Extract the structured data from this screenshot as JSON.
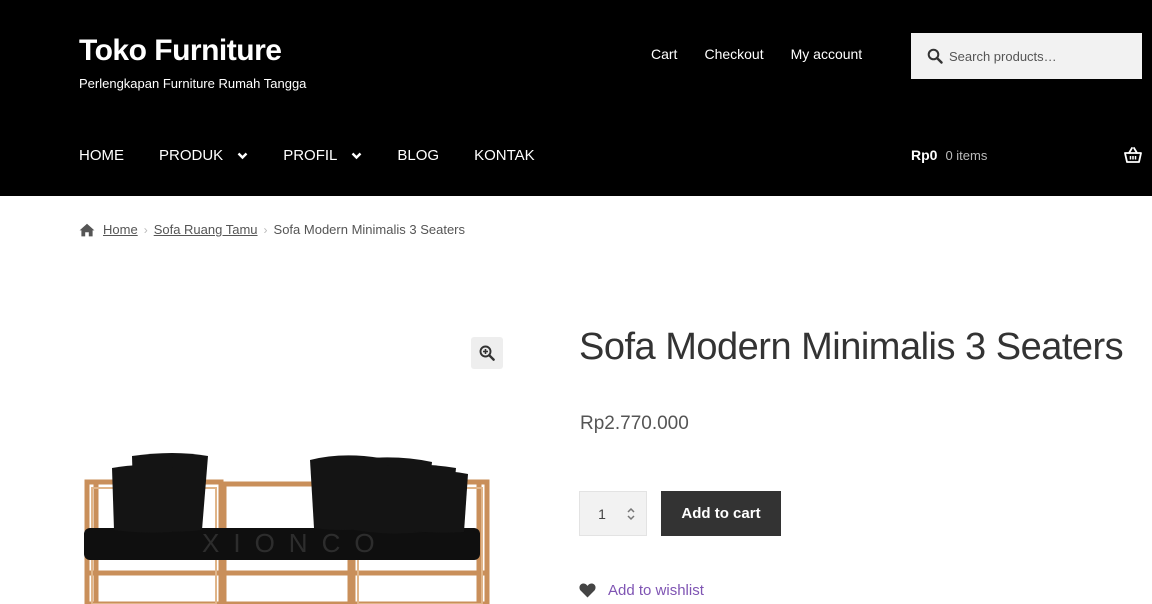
{
  "site": {
    "title": "Toko Furniture",
    "tagline": "Perlengkapan Furniture Rumah Tangga"
  },
  "top_links": [
    "Cart",
    "Checkout",
    "My account"
  ],
  "search": {
    "placeholder": "Search products…",
    "icon": "search-icon"
  },
  "nav": {
    "items": [
      {
        "label": "HOME",
        "has_dropdown": false
      },
      {
        "label": "PRODUK",
        "has_dropdown": true
      },
      {
        "label": "PROFIL",
        "has_dropdown": true
      },
      {
        "label": "BLOG",
        "has_dropdown": false
      },
      {
        "label": "KONTAK",
        "has_dropdown": false
      }
    ]
  },
  "cart": {
    "amount": "Rp0",
    "count": "0 items",
    "icon": "basket-icon"
  },
  "breadcrumb": {
    "home": "Home",
    "category": "Sofa Ruang Tamu",
    "current": "Sofa Modern Minimalis 3 Seaters",
    "separator": "›"
  },
  "product": {
    "title": "Sofa Modern Minimalis 3 Seaters",
    "price": "Rp2.770.000",
    "quantity": "1",
    "add_to_cart": "Add to cart",
    "wishlist": "Add to wishlist",
    "watermark": "XIONCO"
  },
  "colors": {
    "header_bg": "#000000",
    "button_bg": "#333333",
    "wishlist_link": "#7f54b3"
  }
}
